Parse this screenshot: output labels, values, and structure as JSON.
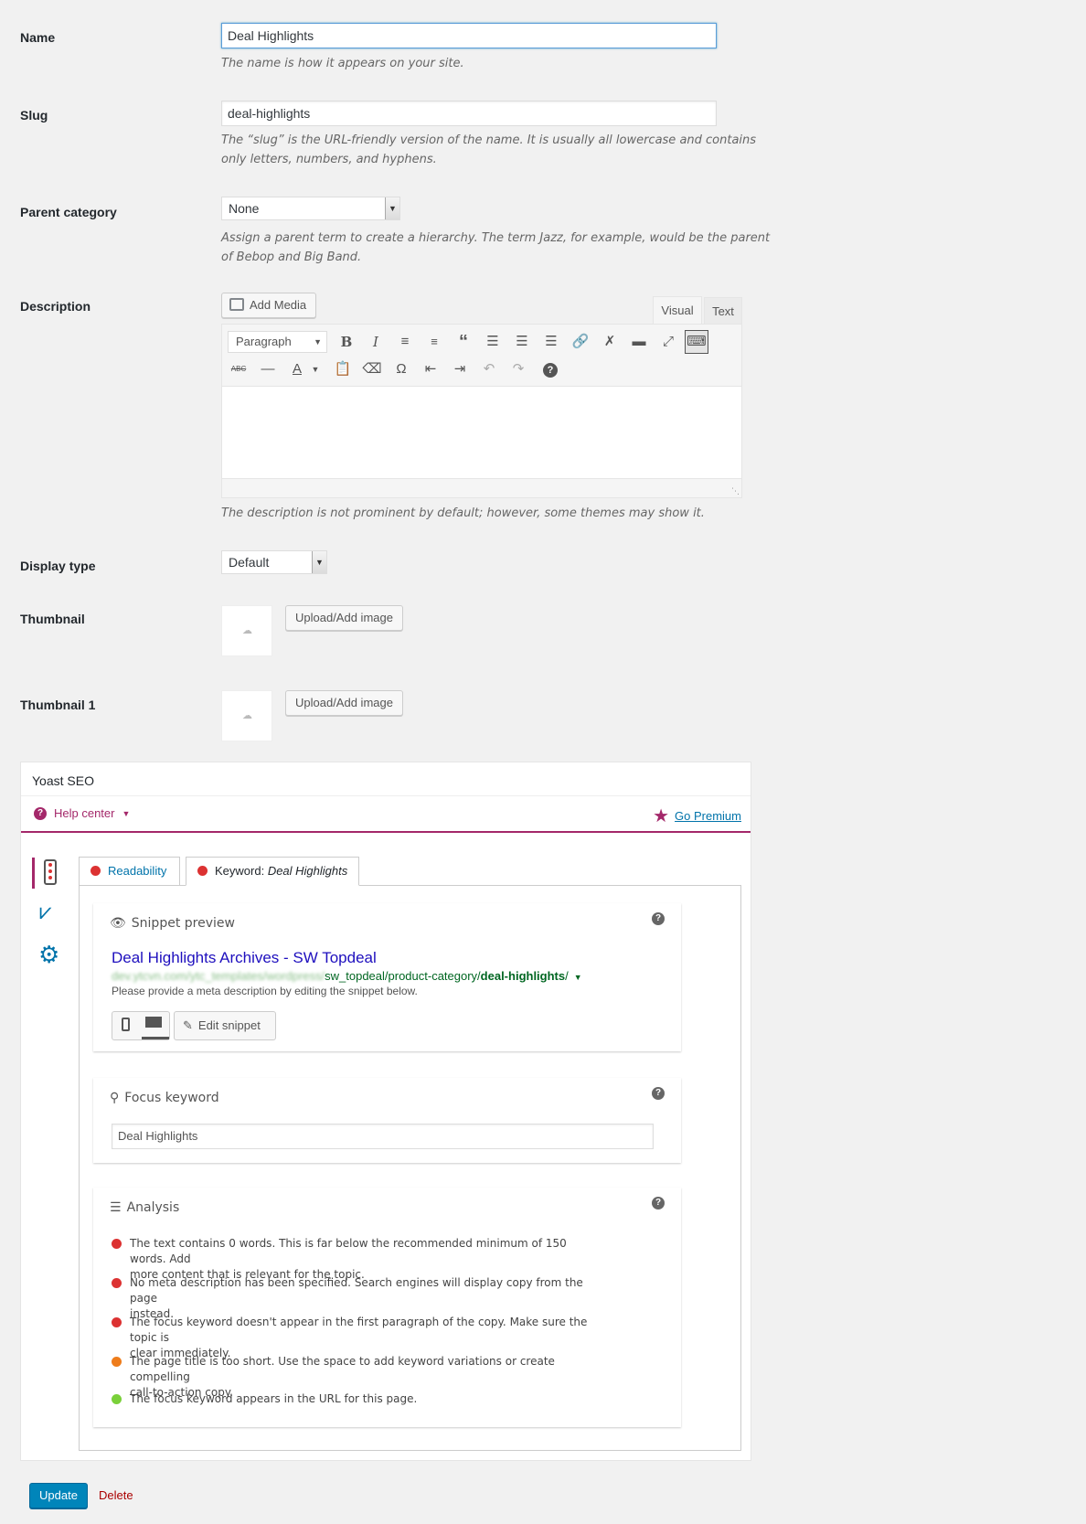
{
  "name": {
    "label": "Name",
    "value": "Deal Highlights",
    "help": "The name is how it appears on your site."
  },
  "slug": {
    "label": "Slug",
    "value": "deal-highlights",
    "help_line1": "The “slug” is the URL-friendly version of the name. It is usually all lowercase and contains",
    "help_line2": "only letters, numbers, and hyphens."
  },
  "parent": {
    "label": "Parent category",
    "value": "None",
    "help_line1": "Assign a parent term to create a hierarchy. The term Jazz, for example, would be the parent",
    "help_line2": "of Bebop and Big Band."
  },
  "description": {
    "label": "Description",
    "add_media": "Add Media",
    "tab_visual": "Visual",
    "tab_text": "Text",
    "format_select": "Paragraph",
    "content": "",
    "help": "The description is not prominent by default; however, some themes may show it."
  },
  "display_type": {
    "label": "Display type",
    "value": "Default"
  },
  "thumbnail": {
    "label": "Thumbnail",
    "button": "Upload/Add image"
  },
  "thumbnail1": {
    "label": "Thumbnail 1",
    "button": "Upload/Add image"
  },
  "yoast": {
    "title": "Yoast SEO",
    "help_center": "Help center",
    "go_premium": "Go Premium",
    "tab_readability": "Readability",
    "tab_keyword_prefix": "Keyword: ",
    "tab_keyword_value": "Deal Highlights",
    "snippet": {
      "heading": "Snippet preview",
      "title": "Deal Highlights Archives - SW Topdeal",
      "url_blurred": "dev.ytcvn.com/ytc_templates/wordpress/",
      "url_path": "sw_topdeal/product-category/",
      "url_slug": "deal-highlights",
      "url_end": "/",
      "meta": "Please provide a meta description by editing the snippet below.",
      "edit_button": "Edit snippet"
    },
    "focus": {
      "heading": "Focus keyword",
      "value": "Deal Highlights"
    },
    "analysis": {
      "heading": "Analysis",
      "items": [
        {
          "color": "#dc3232",
          "line1": "The text contains 0 words. This is far below the recommended minimum of 150 words. Add",
          "line2": "more content that is relevant for the topic."
        },
        {
          "color": "#dc3232",
          "line1": "No meta description has been specified. Search engines will display copy from the page",
          "line2": "instead."
        },
        {
          "color": "#dc3232",
          "line1": "The focus keyword doesn't appear in the first paragraph of the copy. Make sure the topic is",
          "line2": "clear immediately."
        },
        {
          "color": "#ee7c1b",
          "line1": "The page title is too short. Use the space to add keyword variations or create compelling",
          "line2": "call-to-action copy."
        },
        {
          "color": "#7ad03a",
          "line1": "The focus keyword appears in the URL for this page.",
          "line2": ""
        }
      ]
    }
  },
  "actions": {
    "update": "Update",
    "delete": "Delete"
  }
}
